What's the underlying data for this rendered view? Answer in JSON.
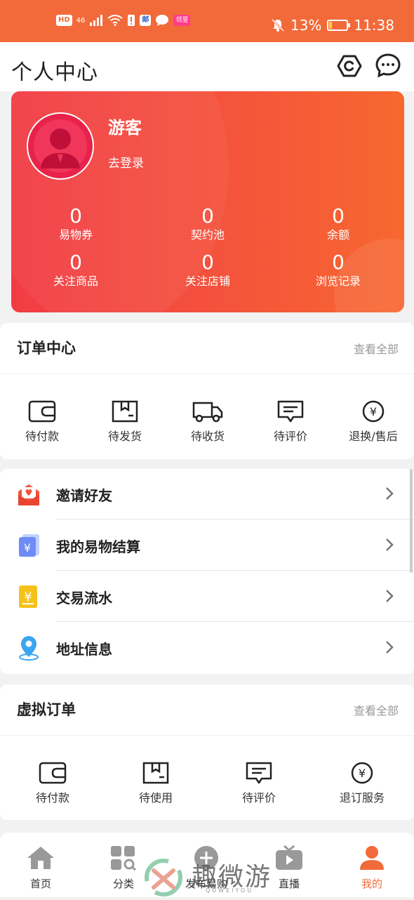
{
  "status_bar": {
    "left_chips": [
      "HD",
      "46"
    ],
    "app_badge": "邮",
    "pink_badge": "邻里",
    "battery_percent": "13%",
    "battery_level": 0.13,
    "time": "11:38"
  },
  "header": {
    "title": "个人中心",
    "icons": [
      "settings-icon",
      "message-icon"
    ]
  },
  "profile": {
    "name": "游客",
    "login_text": "去登录",
    "stats": [
      {
        "value": "0",
        "label": "易物券"
      },
      {
        "value": "0",
        "label": "契约池"
      },
      {
        "value": "0",
        "label": "余额"
      },
      {
        "value": "0",
        "label": "关注商品"
      },
      {
        "value": "0",
        "label": "关注店铺"
      },
      {
        "value": "0",
        "label": "浏览记录"
      }
    ]
  },
  "order_center": {
    "title": "订单中心",
    "more": "查看全部",
    "items": [
      {
        "label": "待付款",
        "icon": "wallet-icon"
      },
      {
        "label": "待发货",
        "icon": "box-icon"
      },
      {
        "label": "待收货",
        "icon": "truck-icon"
      },
      {
        "label": "待评价",
        "icon": "comment-icon"
      },
      {
        "label": "退换/售后",
        "icon": "yen-icon"
      }
    ]
  },
  "menu": [
    {
      "label": "邀请好友",
      "icon": "invite-envelope-icon",
      "color": "#f0553c"
    },
    {
      "label": "我的易物结算",
      "icon": "settlement-card-icon",
      "color": "#6e8cf5"
    },
    {
      "label": "交易流水",
      "icon": "transaction-icon",
      "color": "#f5c21b"
    },
    {
      "label": "地址信息",
      "icon": "location-pin-icon",
      "color": "#3aa5f0"
    }
  ],
  "virtual_orders": {
    "title": "虚拟订单",
    "more": "查看全部",
    "items": [
      {
        "label": "待付款",
        "icon": "wallet-icon"
      },
      {
        "label": "待使用",
        "icon": "box-icon"
      },
      {
        "label": "待评价",
        "icon": "comment-icon"
      },
      {
        "label": "退订服务",
        "icon": "yen-icon"
      }
    ]
  },
  "tabbar": [
    {
      "label": "首页",
      "icon": "home-icon",
      "active": false
    },
    {
      "label": "分类",
      "icon": "category-icon",
      "active": false
    },
    {
      "label": "发布易购",
      "icon": "publish-icon",
      "active": false
    },
    {
      "label": "直播",
      "icon": "live-icon",
      "active": false
    },
    {
      "label": "我的",
      "icon": "profile-icon",
      "active": true
    }
  ],
  "watermark": {
    "text": "趣微游",
    "sub": "QUWEIYOU"
  },
  "colors": {
    "accent": "#f26a3a",
    "card_start": "#f23c45",
    "card_end": "#f7682f"
  }
}
